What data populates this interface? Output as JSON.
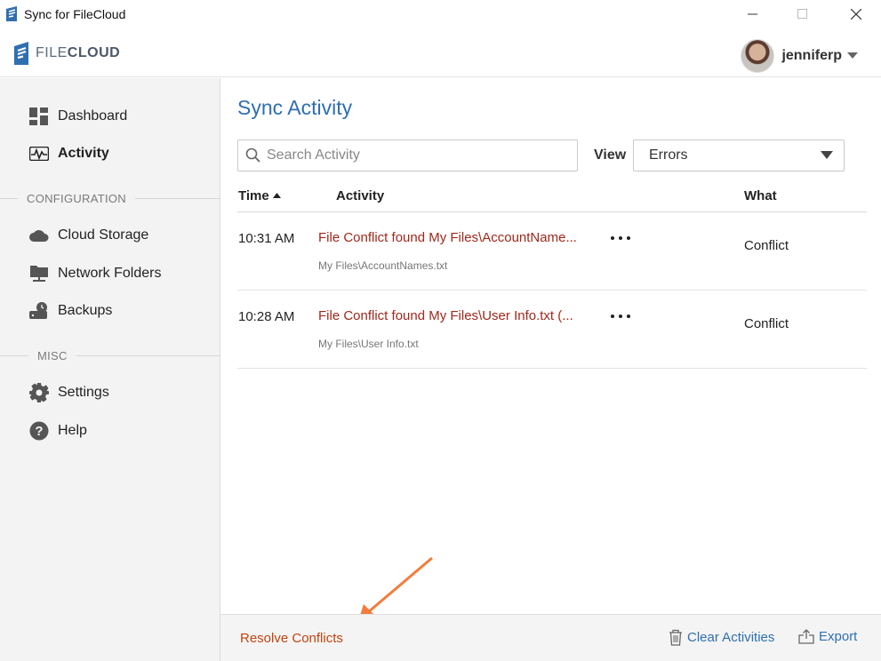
{
  "window": {
    "title": "Sync for FileCloud"
  },
  "header": {
    "logo_light": "FILE",
    "logo_bold": "CLOUD",
    "username": "jenniferp"
  },
  "sidebar": {
    "items": [
      {
        "label": "Dashboard",
        "icon": "dashboard-icon"
      },
      {
        "label": "Activity",
        "icon": "activity-icon",
        "active": true
      }
    ],
    "configuration_title": "CONFIGURATION",
    "configuration": [
      {
        "label": "Cloud Storage",
        "icon": "cloud-icon"
      },
      {
        "label": "Network Folders",
        "icon": "network-folder-icon"
      },
      {
        "label": "Backups",
        "icon": "backup-icon"
      }
    ],
    "misc_title": "MISC",
    "misc": [
      {
        "label": "Settings",
        "icon": "gear-icon"
      },
      {
        "label": "Help",
        "icon": "help-icon"
      }
    ]
  },
  "main": {
    "title": "Sync Activity",
    "search_placeholder": "Search Activity",
    "view_label": "View",
    "view_selected": "Errors",
    "columns": {
      "time": "Time",
      "activity": "Activity",
      "what": "What"
    },
    "rows": [
      {
        "time": "10:31 AM",
        "message": "File Conflict found My Files\\AccountName...",
        "path": "My Files\\AccountNames.txt",
        "what": "Conflict"
      },
      {
        "time": "10:28 AM",
        "message": "File Conflict found My Files\\User Info.txt (...",
        "path": "My Files\\User Info.txt",
        "what": "Conflict"
      }
    ]
  },
  "footer": {
    "resolve": "Resolve Conflicts",
    "clear": "Clear Activities",
    "export": "Export"
  },
  "colors": {
    "accent": "#2f6fb0",
    "error": "#a0281c",
    "resolve": "#c1440e",
    "annotation_arrow": "#f47c3c"
  }
}
